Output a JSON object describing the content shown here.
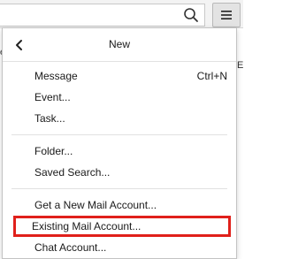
{
  "toolbar": {
    "search_icon": "search-icon",
    "menu_icon": "hamburger-menu-icon"
  },
  "behind": {
    "left_fragment": "e",
    "right_fragment": "E"
  },
  "panel": {
    "title": "New",
    "back_icon": "chevron-left-icon",
    "groups": [
      [
        {
          "label": "Message",
          "shortcut": "Ctrl+N"
        },
        {
          "label": "Event..."
        },
        {
          "label": "Task..."
        }
      ],
      [
        {
          "label": "Folder..."
        },
        {
          "label": "Saved Search..."
        }
      ],
      [
        {
          "label": "Get a New Mail Account..."
        },
        {
          "label": "Existing Mail Account...",
          "highlighted": true
        },
        {
          "label": "Chat Account..."
        }
      ]
    ]
  },
  "colors": {
    "highlight_border": "#e0201b"
  }
}
